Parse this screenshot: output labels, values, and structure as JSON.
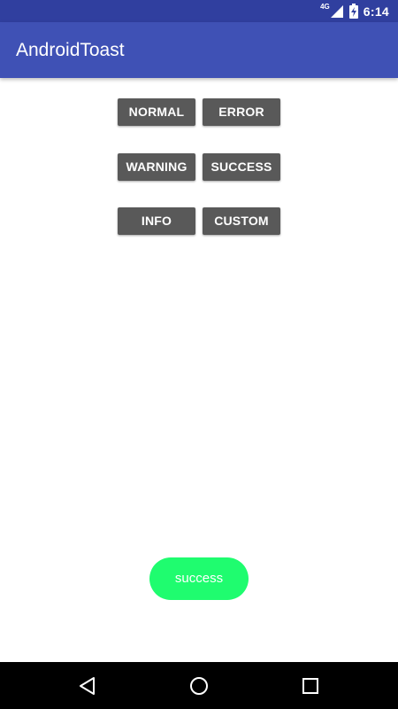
{
  "status_bar": {
    "network": "4G",
    "time": "6:14",
    "icons": [
      "signal-icon",
      "battery-charging-icon"
    ]
  },
  "app_bar": {
    "title": "AndroidToast"
  },
  "buttons": {
    "normal": "NORMAL",
    "error": "ERROR",
    "warning": "WARNING",
    "success": "SUCCESS",
    "info": "INFO",
    "custom": "CUSTOM"
  },
  "toast": {
    "text": "success",
    "color": "#1ffc6f"
  },
  "nav_bar": {
    "icons": [
      "back-icon",
      "home-icon",
      "recents-icon"
    ]
  },
  "colors": {
    "status_bar": "#303f9f",
    "app_bar": "#3f51b5",
    "button": "#595959"
  }
}
